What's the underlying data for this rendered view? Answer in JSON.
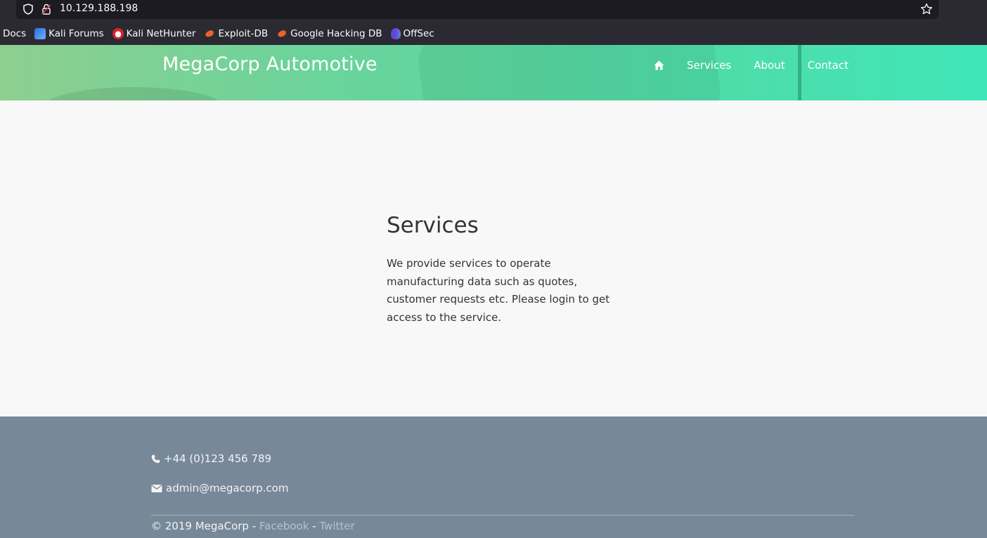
{
  "browser": {
    "url": "10.129.188.198",
    "bookmarks": [
      {
        "label": "Docs",
        "icon": "none"
      },
      {
        "label": "Kali Forums",
        "icon": "kali-forums-icon"
      },
      {
        "label": "Kali NetHunter",
        "icon": "kali-nethunter-icon"
      },
      {
        "label": "Exploit-DB",
        "icon": "exploit-db-icon"
      },
      {
        "label": "Google Hacking DB",
        "icon": "exploit-db-icon"
      },
      {
        "label": "OffSec",
        "icon": "offsec-icon"
      }
    ]
  },
  "header": {
    "brand": "MegaCorp Automotive",
    "nav": {
      "home_icon": "home-icon",
      "services": "Services",
      "about": "About",
      "contact": "Contact"
    }
  },
  "main": {
    "title": "Services",
    "text": "We provide services to operate manufacturing data such as quotes, customer requests etc. Please login to get access to the service."
  },
  "footer": {
    "phone": "+44 (0)123 456 789",
    "email": "admin@megacorp.com",
    "copyright": "© 2019 MegaCorp -",
    "separator": "-",
    "facebook": "Facebook",
    "twitter": "Twitter"
  },
  "colors": {
    "header_gradient_start": "#8ecf8f",
    "header_gradient_end": "#3fe6b8",
    "footer_bg": "#778899",
    "link": "#b7c2cc"
  }
}
